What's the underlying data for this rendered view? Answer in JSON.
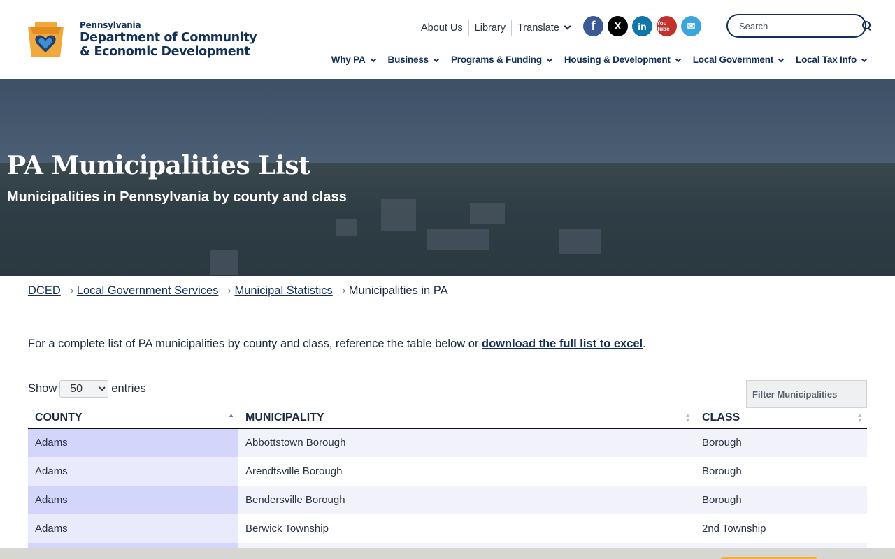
{
  "logo": {
    "line1": "Pennsylvania",
    "line2": "Department of Community",
    "line3": "& Economic Development"
  },
  "util_nav": [
    {
      "label": "About Us"
    },
    {
      "label": "Library"
    },
    {
      "label": "Translate"
    }
  ],
  "socials": {
    "facebook": "f",
    "x": "X",
    "linkedin": "in",
    "youtube": "You Tube",
    "email": "✉"
  },
  "search": {
    "placeholder": "Search"
  },
  "main_nav": [
    {
      "label": "Why PA"
    },
    {
      "label": "Business"
    },
    {
      "label": "Programs & Funding"
    },
    {
      "label": "Housing & Development"
    },
    {
      "label": "Local Government"
    },
    {
      "label": "Local Tax Info"
    }
  ],
  "hero": {
    "title": "PA Municipalities List",
    "subtitle": "Municipalities in Pennsylvania by county and class"
  },
  "breadcrumb": [
    {
      "label": "DCED"
    },
    {
      "label": "Local Government Services"
    },
    {
      "label": "Municipal Statistics"
    },
    {
      "label": "Municipalities in PA"
    }
  ],
  "intro": {
    "text": "For a complete list of PA municipalities by county and class, reference the table below or ",
    "link": "download the full list to excel",
    "end": "."
  },
  "table_controls": {
    "show_label": "Show",
    "entries_value": "50",
    "entries_label": "entries",
    "filter_placeholder": "Filter Municipalities"
  },
  "table": {
    "headers": [
      "COUNTY",
      "MUNICIPALITY",
      "CLASS"
    ],
    "rows": [
      [
        "Adams",
        "Abbottstown Borough",
        "Borough"
      ],
      [
        "Adams",
        "Arendtsville Borough",
        "Borough"
      ],
      [
        "Adams",
        "Bendersville Borough",
        "Borough"
      ],
      [
        "Adams",
        "Berwick Township",
        "2nd Township"
      ],
      [
        "",
        "",
        ""
      ]
    ]
  }
}
